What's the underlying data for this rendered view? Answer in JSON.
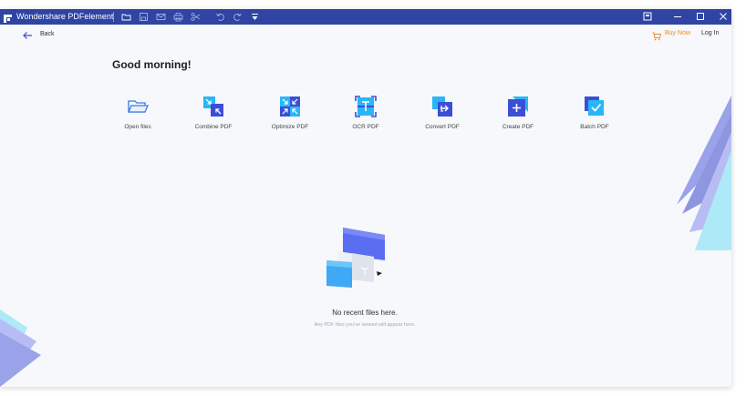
{
  "window": {
    "app_title": "Wondershare PDFelement",
    "toolbar_icons": [
      "folder-icon",
      "save-icon",
      "mail-icon",
      "print-icon",
      "cut-icon",
      "undo-icon",
      "redo-icon",
      "customize-toolbar-icon"
    ],
    "controls": [
      "restore-panel-icon",
      "minimize-icon",
      "maximize-icon",
      "close-icon"
    ]
  },
  "header": {
    "back_label": "Back",
    "buy_now_label": "Buy Now",
    "login_label": "Log In"
  },
  "greeting": "Good morning!",
  "tools": [
    {
      "label": "Open files",
      "icon": "folder-open-icon"
    },
    {
      "label": "Combine PDF",
      "icon": "combine-icon"
    },
    {
      "label": "Optimize PDF",
      "icon": "optimize-icon"
    },
    {
      "label": "OCR PDF",
      "icon": "ocr-icon"
    },
    {
      "label": "Convert PDF",
      "icon": "convert-icon"
    },
    {
      "label": "Create PDF",
      "icon": "create-icon"
    },
    {
      "label": "Batch PDF",
      "icon": "batch-icon"
    }
  ],
  "recent": {
    "empty_title": "No recent files here.",
    "empty_subtitle": "Any PDF files you've viewed will appear here."
  },
  "colors": {
    "titlebar": "#2f44a3",
    "accent_blue": "#3b5bdb",
    "buy_now": "#f08a24",
    "background": "#f7f8fb"
  }
}
